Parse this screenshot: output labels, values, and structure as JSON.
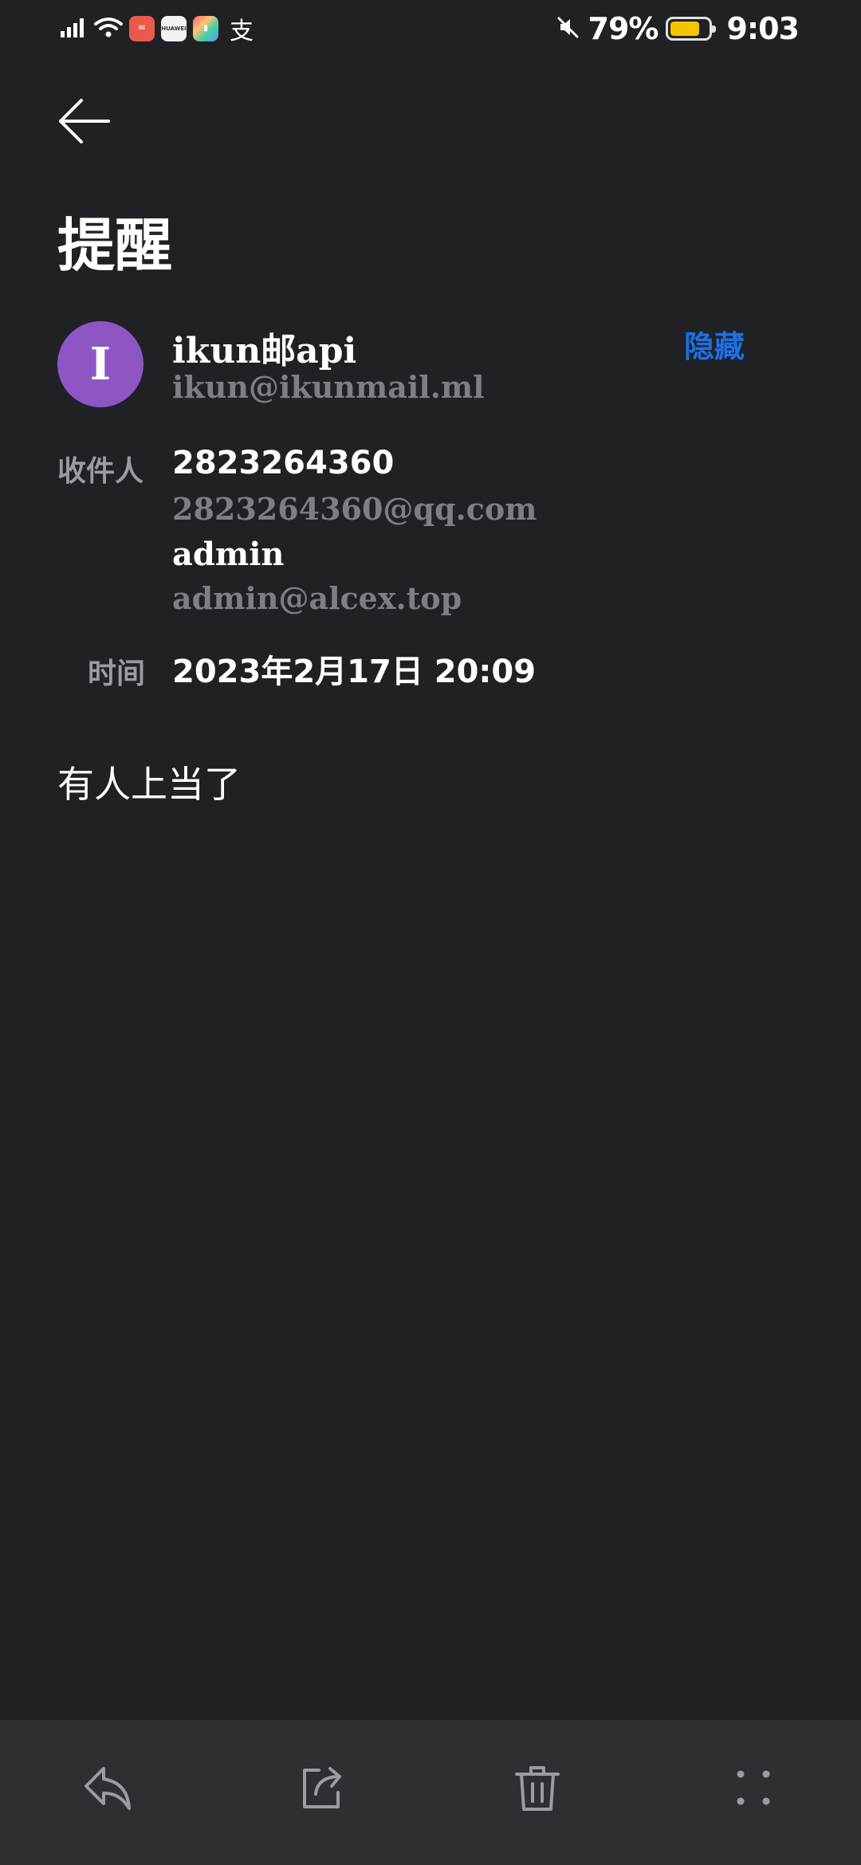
{
  "status_bar": {
    "battery_percent": "79%",
    "battery_level": 0.79,
    "time": "9:03",
    "app_icons": [
      "mail-app-icon",
      "huawei-app-icon",
      "colorful-app-icon",
      "alipay-icon"
    ],
    "alipay_glyph": "支",
    "huawei_label": "HUAWEI",
    "colors": {
      "battery_fill": "#f5c400"
    }
  },
  "header": {
    "title": "提醒"
  },
  "sender": {
    "avatar_letter": "I",
    "avatar_color": "#8e55c4",
    "name": "ikun邮api",
    "email": "ikun@ikunmail.ml",
    "hide_label": "隐藏"
  },
  "details": {
    "recipient_label": "收件人",
    "recipients": [
      {
        "name": "2823264360",
        "email": "2823264360@qq.com"
      },
      {
        "name": "admin",
        "email": "admin@alcex.top"
      }
    ],
    "time_label": "时间",
    "time_value": "2023年2月17日 20:09"
  },
  "body": {
    "text": "有人上当了"
  },
  "toolbar": {
    "items": [
      "reply-icon",
      "share-icon",
      "delete-icon",
      "more-icon"
    ]
  },
  "colors": {
    "background": "#202124",
    "toolbar": "#2e2f33",
    "accent": "#1d6fe3",
    "muted_text": "#7d7f84"
  }
}
